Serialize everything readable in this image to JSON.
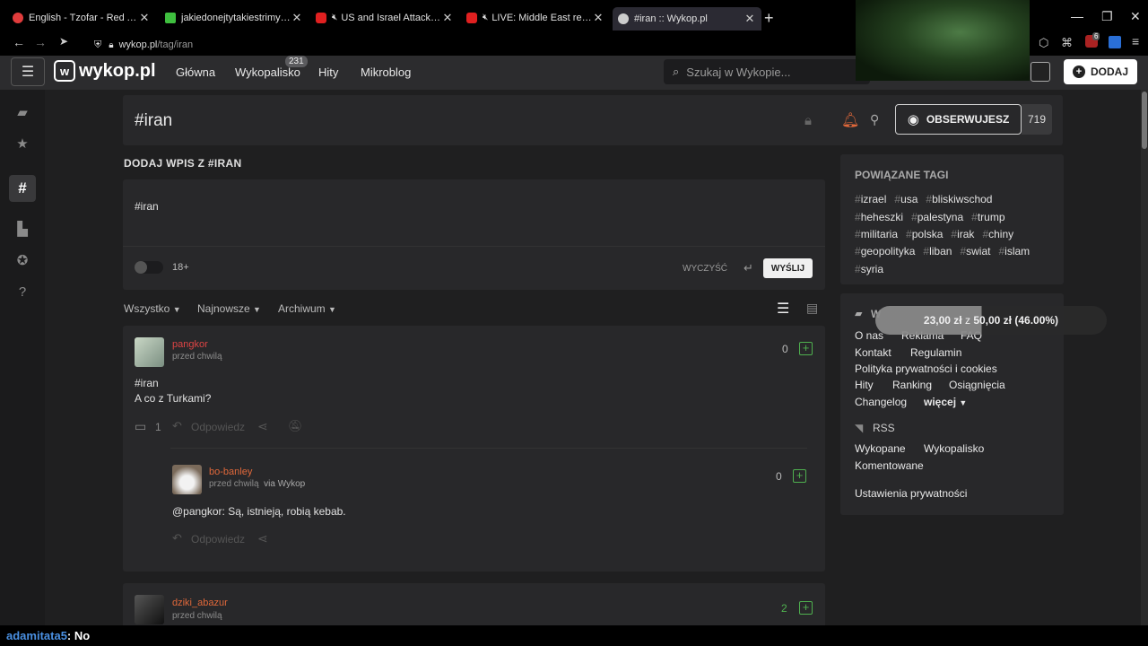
{
  "browser": {
    "tabs": [
      {
        "title": "English - Tzofar - Red Alert",
        "icon_color": "#e03c3c"
      },
      {
        "title": "jakiedonejtytakiestrimyxD Strea",
        "icon_color": "#3fbf3f"
      },
      {
        "title": "US and Israel Attack Iran - L",
        "icon_color": "#e02020"
      },
      {
        "title": "LIVE: Middle East real-time",
        "icon_color": "#e02020"
      },
      {
        "title": "#iran :: Wykop.pl",
        "icon_color": "#cccccc"
      }
    ],
    "url_domain": "wykop.pl",
    "url_path": "/tag/iran",
    "ext_badge": "6"
  },
  "header": {
    "logo": "wykop.pl",
    "nav": [
      "Główna",
      "Wykopalisko",
      "Hity",
      "Mikroblog"
    ],
    "wykopalisko_badge": "231",
    "search_placeholder": "Szukaj w Wykopie...",
    "add_label": "DODAJ"
  },
  "tag": {
    "title": "#iran",
    "observe_label": "OBSERWUJESZ",
    "observe_count": "719"
  },
  "composer": {
    "heading": "DODAJ WPIS Z #IRAN",
    "value": "#iran",
    "nsfw_label": "18+",
    "clear_label": "WYCZYŚĆ",
    "send_label": "WYŚLIJ"
  },
  "filters": [
    "Wszystko",
    "Najnowsze",
    "Archiwum"
  ],
  "posts": [
    {
      "user": "pangkor",
      "time": "przed chwilą",
      "votes": "0",
      "lines": [
        "#iran",
        "A co z Turkami?"
      ],
      "comments": "1",
      "reply_label": "Odpowiedz"
    }
  ],
  "reply": {
    "user": "bo-banley",
    "time": "przed chwilą",
    "via": "via Wykop",
    "votes": "0",
    "mention": "@pangkor",
    "text": ": Są, istnieją, robią kebab.",
    "reply_label": "Odpowiedz"
  },
  "post3": {
    "user": "dziki_abazur",
    "time": "przed chwilą",
    "votes": "2"
  },
  "related": {
    "heading": "POWIĄZANE TAGI",
    "rows": [
      [
        "izrael",
        "usa",
        "bliskiwschod"
      ],
      [
        "heheszki",
        "palestyna",
        "trump"
      ],
      [
        "militaria",
        "polska",
        "irak",
        "chiny"
      ],
      [
        "geopolityka",
        "liban",
        "swiat",
        "islam"
      ],
      [
        "syria"
      ]
    ]
  },
  "footer": {
    "heading": "W",
    "links_row1": [
      "O nas",
      "Reklama",
      "FAQ"
    ],
    "links_row2": [
      "Kontakt",
      "Regulamin"
    ],
    "links_row3": [
      "Polityka prywatności i cookies"
    ],
    "links_row4": [
      "Hity",
      "Ranking",
      "Osiągnięcia"
    ],
    "changelog": "Changelog",
    "more": "więcej",
    "rss": "RSS",
    "rss_links": [
      "Wykopane",
      "Wykopalisko",
      "Komentowane"
    ],
    "privacy": "Ustawienia prywatności"
  },
  "donation": {
    "current": "23,00 zł",
    "sep": "z",
    "goal": "50,00 zł",
    "pct": "(46.00%)",
    "progress": 0.46
  },
  "chat": {
    "user": "adamitata5",
    "message": ": No"
  }
}
